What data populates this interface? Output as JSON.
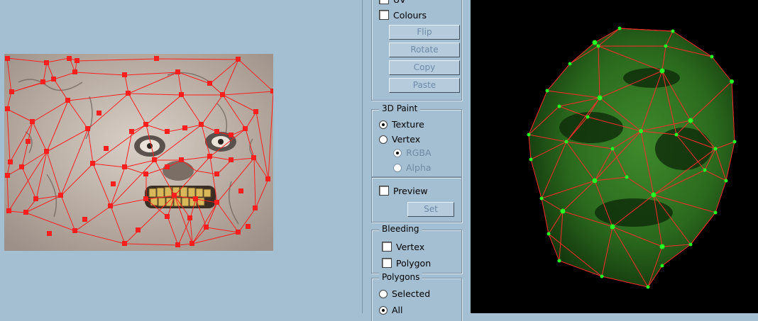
{
  "uv_options": {
    "uv_label": "UV",
    "colours_label": "Colours",
    "uv_checked": false,
    "colours_checked": false
  },
  "actions": {
    "flip": "Flip",
    "rotate": "Rotate",
    "copy": "Copy",
    "paste": "Paste"
  },
  "paint_3d": {
    "title": "3D Paint",
    "texture": "Texture",
    "vertex": "Vertex",
    "rgba": "RGBA",
    "alpha": "Alpha",
    "selected_mode": "Texture",
    "selected_channel": "RGBA"
  },
  "preview": {
    "label": "Preview",
    "checked": false,
    "set_label": "Set"
  },
  "bleeding": {
    "title": "Bleeding",
    "vertex": "Vertex",
    "polygon": "Polygon",
    "vertex_checked": false,
    "polygon_checked": false
  },
  "polygons": {
    "title": "Polygons",
    "selected": "Selected",
    "all": "All",
    "current": "All"
  },
  "colors": {
    "background": "#a4bed2",
    "wire": "#ff2a2a",
    "vertex_3d": "#22ff22",
    "face_green": "#2f7a22",
    "viewport": "#000000"
  }
}
